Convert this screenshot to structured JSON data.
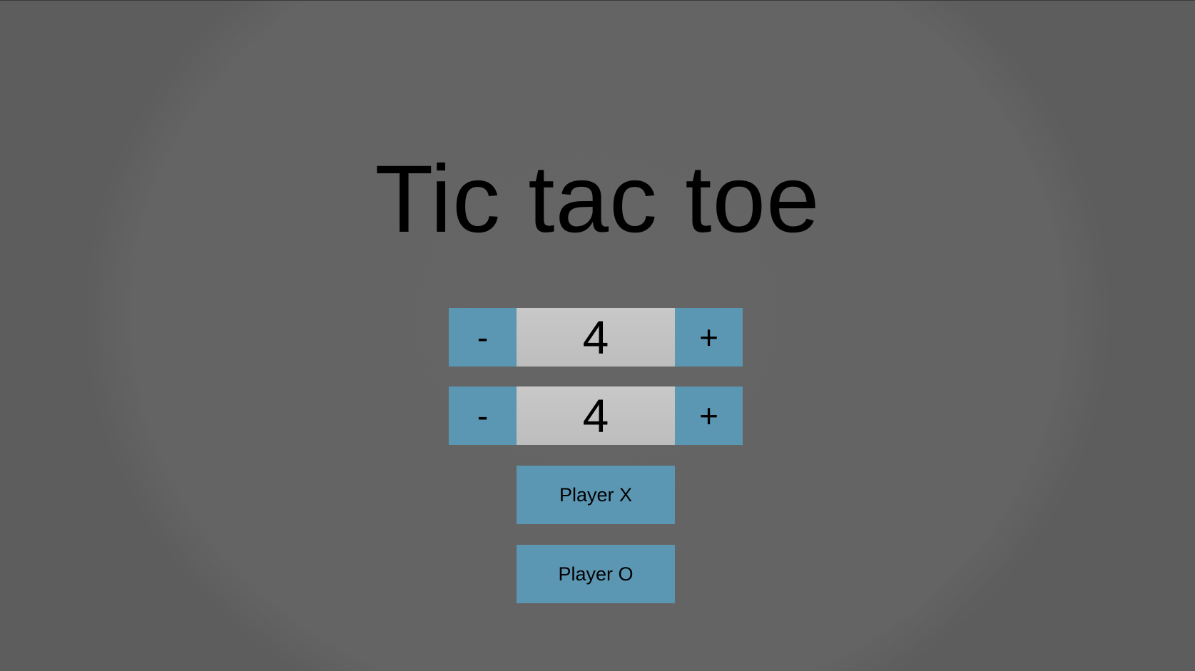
{
  "title": "Tic tac toe",
  "rows_stepper": {
    "decrement_label": "-",
    "value": "4",
    "increment_label": "+"
  },
  "cols_stepper": {
    "decrement_label": "-",
    "value": "4",
    "increment_label": "+"
  },
  "buttons": {
    "player_x": "Player X",
    "player_o": "Player O"
  },
  "colors": {
    "background": "#5e5e5e",
    "button": "#5b97b3",
    "value_box": "#c4c4c4",
    "text": "#000000"
  }
}
